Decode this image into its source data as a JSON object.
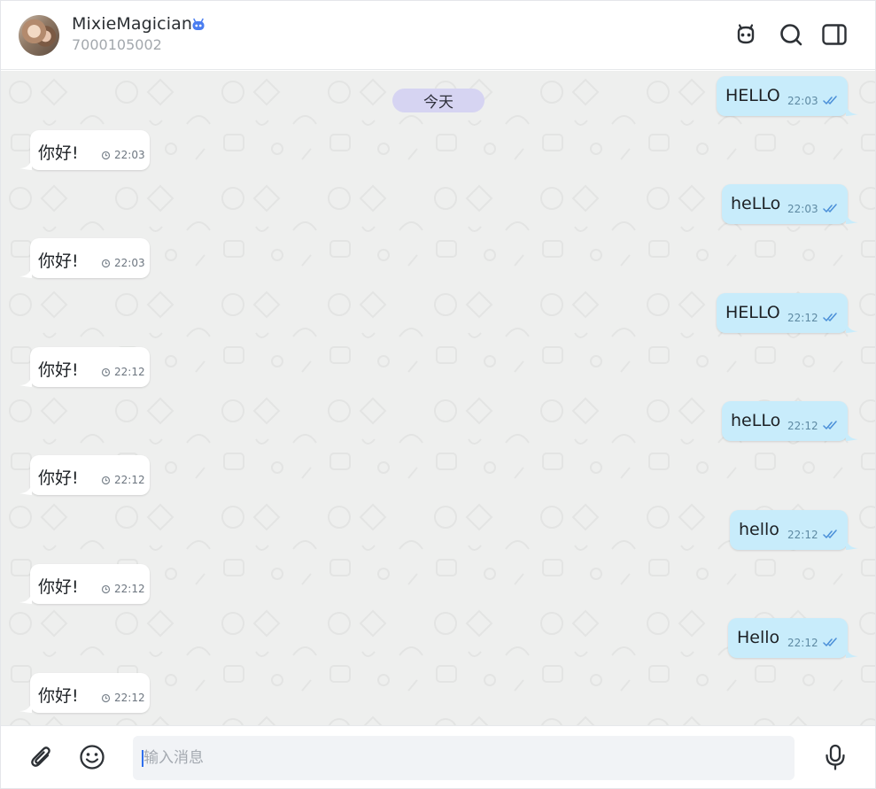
{
  "header": {
    "contact_name": "MixieMagician",
    "contact_id": "7000105002",
    "icons": {
      "bot_badge": "robot-badge-icon",
      "bot_button": "robot-icon",
      "search_button": "search-icon",
      "side_panel_button": "side-panel-icon"
    }
  },
  "chat": {
    "date_separator": "今天",
    "messages": [
      {
        "dir": "out",
        "text": "HELLO",
        "time": "22:03",
        "status": "read"
      },
      {
        "dir": "in",
        "text": "你好!",
        "time": "22:03",
        "status": "pending"
      },
      {
        "dir": "out",
        "text": "heLLo",
        "time": "22:03",
        "status": "read"
      },
      {
        "dir": "in",
        "text": "你好!",
        "time": "22:03",
        "status": "pending"
      },
      {
        "dir": "out",
        "text": "HELLO",
        "time": "22:12",
        "status": "read"
      },
      {
        "dir": "in",
        "text": "你好!",
        "time": "22:12",
        "status": "pending"
      },
      {
        "dir": "out",
        "text": "heLLo",
        "time": "22:12",
        "status": "read"
      },
      {
        "dir": "in",
        "text": "你好!",
        "time": "22:12",
        "status": "pending"
      },
      {
        "dir": "out",
        "text": "hello",
        "time": "22:12",
        "status": "read"
      },
      {
        "dir": "in",
        "text": "你好!",
        "time": "22:12",
        "status": "pending"
      },
      {
        "dir": "out",
        "text": "Hello",
        "time": "22:12",
        "status": "read"
      },
      {
        "dir": "in",
        "text": "你好!",
        "time": "22:12",
        "status": "pending"
      }
    ]
  },
  "composer": {
    "placeholder": "输入消息",
    "value": "",
    "icons": {
      "attach": "paperclip-icon",
      "emoji": "emoji-icon",
      "voice": "microphone-icon"
    }
  },
  "colors": {
    "incoming_bubble": "#ffffff",
    "outgoing_bubble": "#c8ecfb",
    "chat_background": "#eeefee",
    "date_chip": "#d6d4f2",
    "read_ticks": "#4a8fd8",
    "bot_badge": "#4a7df0"
  }
}
